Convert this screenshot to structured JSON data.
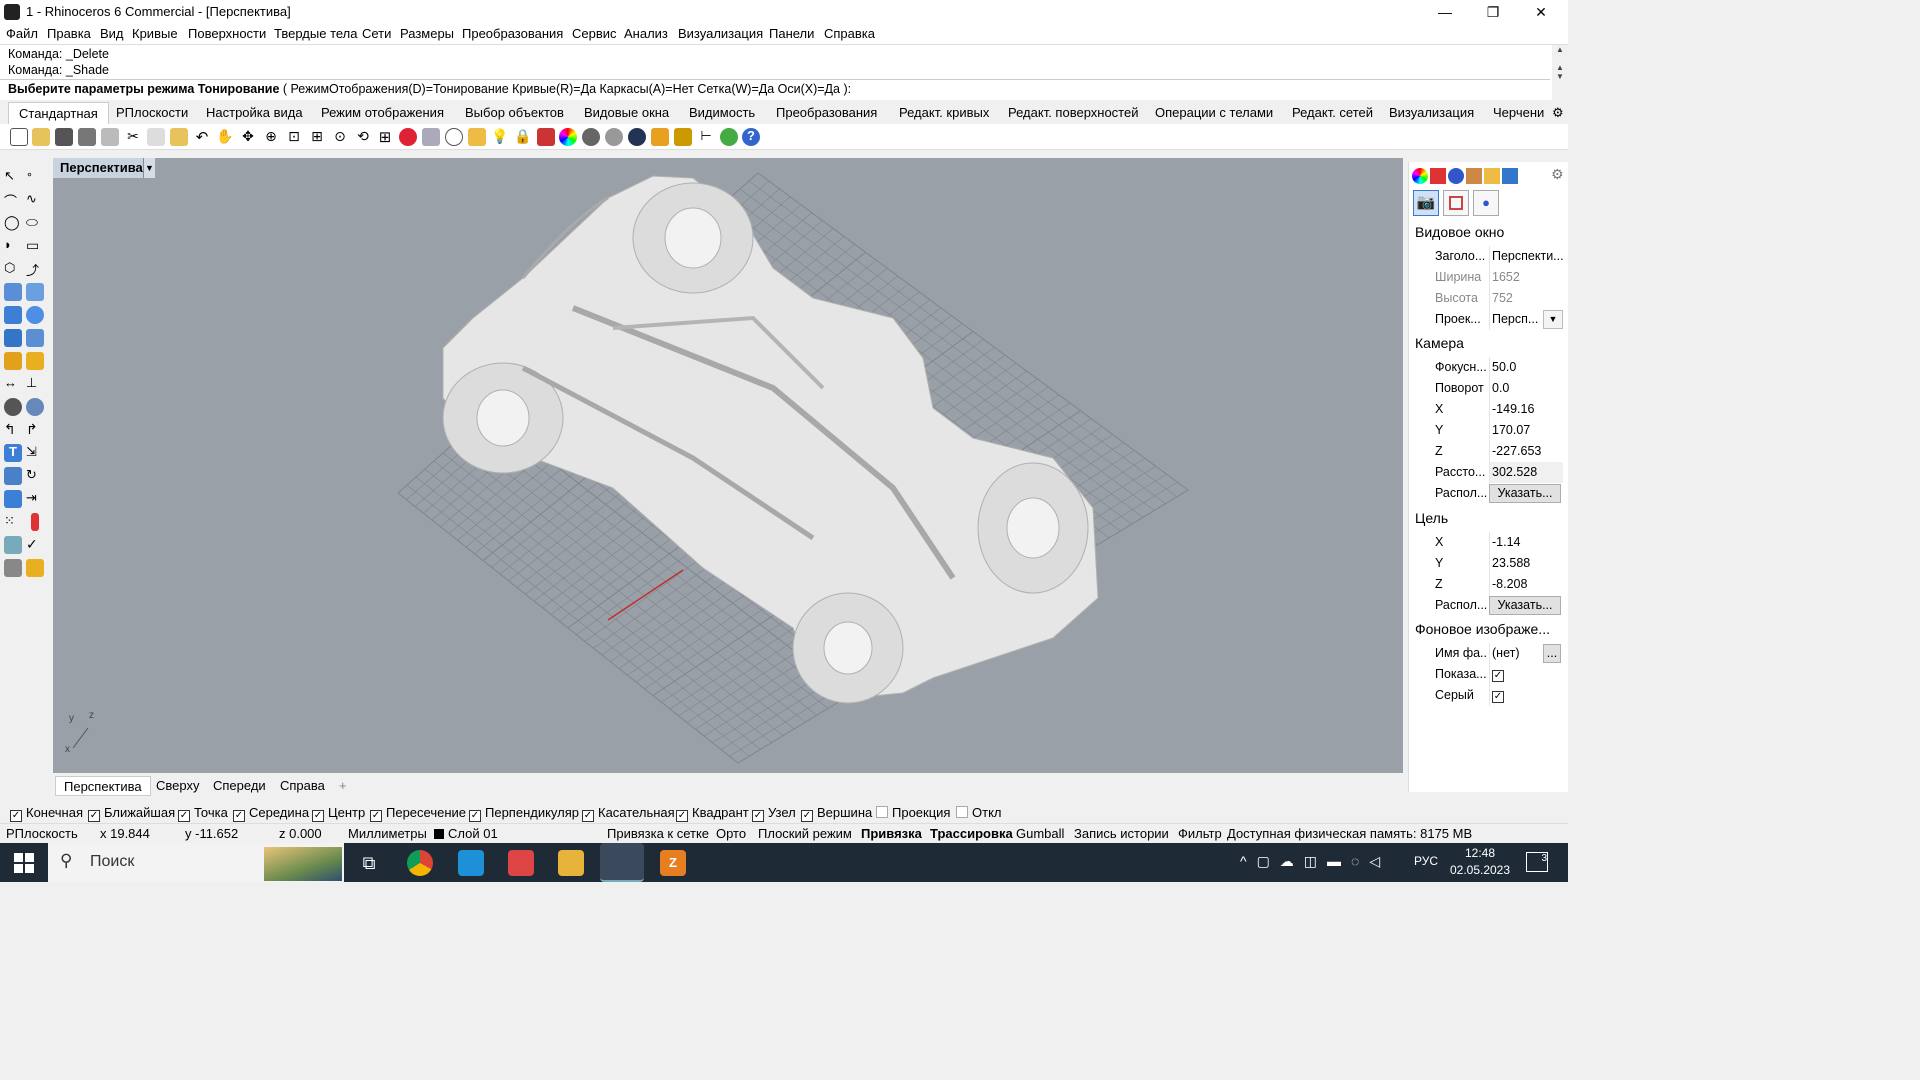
{
  "window": {
    "title": "1 - Rhinoceros 6 Commercial - [Перспектива]",
    "minimize": "—",
    "maximize": "❐",
    "close": "✕"
  },
  "menu": [
    "Файл",
    "Правка",
    "Вид",
    "Кривые",
    "Поверхности",
    "Твердые тела",
    "Сети",
    "Размеры",
    "Преобразования",
    "Сервис",
    "Анализ",
    "Визуализация",
    "Панели",
    "Справка"
  ],
  "command": {
    "history": [
      "Команда: _Delete",
      "Команда: _Shade"
    ],
    "prompt_bold": "Выберите параметры режима Тонирование",
    "prompt_options": " ( РежимОтображения(D)=Тонирование  Кривые(R)=Да  Каркасы(A)=Нет  Сетка(W)=Да  Оси(X)=Да ):"
  },
  "toolbar_tabs": [
    "Стандартная",
    "РПлоскости",
    "Настройка вида",
    "Режим отображения",
    "Выбор объектов",
    "Видовые окна",
    "Видимость",
    "Преобразования",
    "Редакт. кривых",
    "Редакт. поверхностей",
    "Операции с телами",
    "Редакт. сетей",
    "Визуализация",
    "Черчени"
  ],
  "viewport": {
    "title": "Перспектива",
    "axis_labels": {
      "x": "x",
      "y": "y",
      "z": "z"
    },
    "tabs": [
      "Перспектива",
      "Сверху",
      "Спереди",
      "Справа"
    ],
    "add_tab": "+"
  },
  "properties": {
    "viewport_heading": "Видовое окно",
    "rows_viewport": [
      {
        "label": "Заголо...",
        "value": "Перспекти..."
      },
      {
        "label": "Ширина",
        "value": "1652"
      },
      {
        "label": "Высота",
        "value": "752"
      },
      {
        "label": "Проек...",
        "value": "Персп..."
      }
    ],
    "camera_heading": "Камера",
    "rows_camera": [
      {
        "label": "Фокусн...",
        "value": "50.0"
      },
      {
        "label": "Поворот",
        "value": "0.0"
      },
      {
        "label": "X",
        "value": "-149.16"
      },
      {
        "label": "Y",
        "value": "170.07"
      },
      {
        "label": "Z",
        "value": "-227.653"
      },
      {
        "label": "Рассто...",
        "value": "302.528"
      },
      {
        "label": "Распол...",
        "button": "Указать..."
      }
    ],
    "target_heading": "Цель",
    "rows_target": [
      {
        "label": "X",
        "value": "-1.14"
      },
      {
        "label": "Y",
        "value": "23.588"
      },
      {
        "label": "Z",
        "value": "-8.208"
      },
      {
        "label": "Распол...",
        "button": "Указать..."
      }
    ],
    "background_heading": "Фоновое изображе...",
    "rows_background": [
      {
        "label": "Имя фа...",
        "value": "(нет)",
        "button": "..."
      },
      {
        "label": "Показа...",
        "checked": true
      },
      {
        "label": "Серый",
        "checked": true
      }
    ]
  },
  "osnap": [
    {
      "label": "Конечная",
      "checked": true
    },
    {
      "label": "Ближайшая",
      "checked": true
    },
    {
      "label": "Точка",
      "checked": true
    },
    {
      "label": "Середина",
      "checked": true
    },
    {
      "label": "Центр",
      "checked": true
    },
    {
      "label": "Пересечение",
      "checked": true
    },
    {
      "label": "Перпендикуляр",
      "checked": true
    },
    {
      "label": "Касательная",
      "checked": true
    },
    {
      "label": "Квадрант",
      "checked": true
    },
    {
      "label": "Узел",
      "checked": true
    },
    {
      "label": "Вершина",
      "checked": true
    },
    {
      "label": "Проекция",
      "checked": false
    },
    {
      "label": "Откл",
      "checked": false
    }
  ],
  "status": {
    "cplane": "РПлоскость",
    "x": "x 19.844",
    "y": "y -11.652",
    "z": "z 0.000",
    "units": "Миллиметры",
    "layer": "Слой 01",
    "grid_snap": "Привязка к сетке",
    "ortho": "Орто",
    "planar": "Плоский режим",
    "osnap": "Привязка",
    "smarttrack": "Трассировка",
    "gumball": "Gumball",
    "history": "Запись истории",
    "filter": "Фильтр",
    "memory": "Доступная физическая память: 8175 MB"
  },
  "taskbar": {
    "search": "Поиск",
    "lang": "РУС",
    "time": "12:48",
    "date": "02.05.2023",
    "notifications": "3"
  },
  "colors": {
    "viewport_bg": "#9aa0a8",
    "grid": "#7f858d",
    "x_axis": "#c03030",
    "taskbar": "#1f2a37"
  }
}
